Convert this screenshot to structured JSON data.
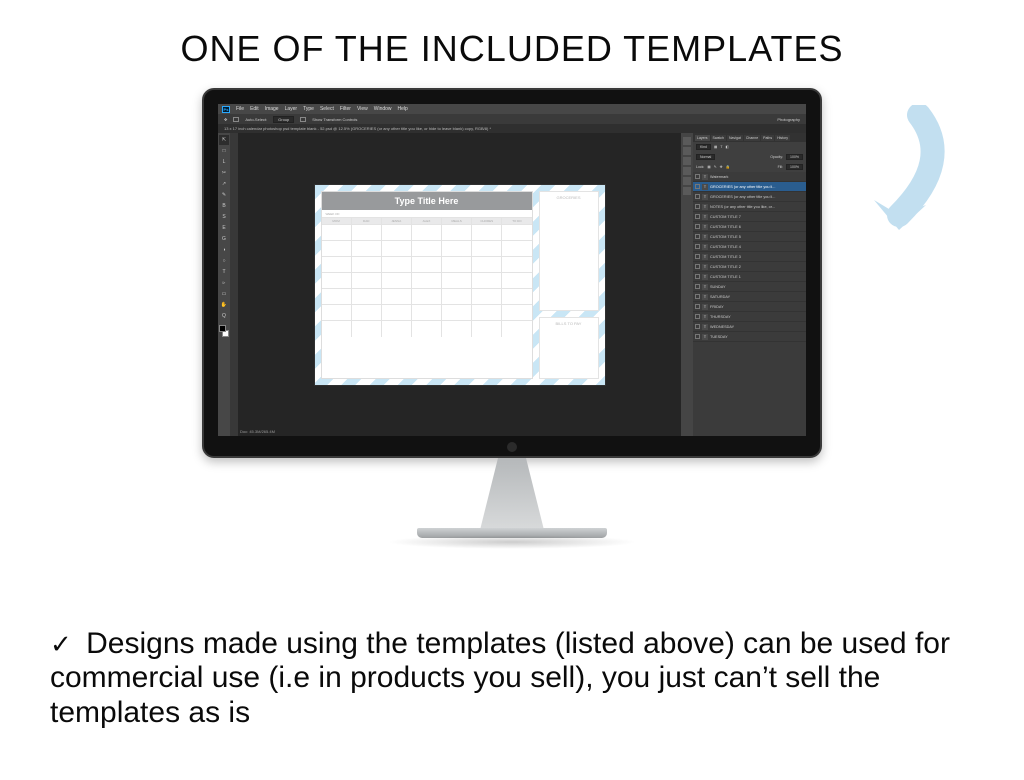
{
  "heading": "ONE OF THE INCLUDED TEMPLATES",
  "body_text": "Designs made using the templates (listed above) can be used for commercial use (i.e in products you sell), you just can’t sell the templates as is",
  "checkmark": "✓",
  "photoshop": {
    "logo": "Ps",
    "menu": [
      "File",
      "Edit",
      "Image",
      "Layer",
      "Type",
      "Select",
      "Filter",
      "View",
      "Window",
      "Help"
    ],
    "options": {
      "auto_select": "Auto-Select:",
      "group": "Group",
      "show_transform": "Show Transform Controls",
      "workspace": "Photography"
    },
    "tab_title": "13 x 17 inch calendar photoshop psd template blank - 52.psd @ 12.5% (GROCERIES (or any other title you like, or hide to leave blank) copy, RGB/8) *",
    "status": "Doc: 45.3M/265.4M",
    "tools": [
      "⇱",
      "□",
      "L",
      "✂",
      "↗",
      "✎",
      "B",
      "S",
      "E",
      "G",
      "◑",
      "○",
      "T",
      "▹",
      "▭",
      "✋",
      "Q"
    ],
    "right_panel_tabs": [
      "Layers",
      "Swatch",
      "Navigat",
      "Channe",
      "Paths",
      "History"
    ],
    "layer_controls": {
      "kind": "Kind",
      "mode": "Normal",
      "opacity_label": "Opacity:",
      "opacity": "100%",
      "lock_label": "Lock:",
      "fill_label": "Fill:",
      "fill": "100%"
    },
    "layers": [
      {
        "type": "T",
        "name": "Watermark",
        "selected": false
      },
      {
        "type": "T",
        "name": "GROCERIES (or any other title you li...",
        "selected": true
      },
      {
        "type": "T",
        "name": "GROCERIES (or any other title you li...",
        "selected": false
      },
      {
        "type": "T",
        "name": "NOTES (or any other title you like, or...",
        "selected": false
      },
      {
        "type": "T",
        "name": "CUSTOM TITLE 7",
        "selected": false
      },
      {
        "type": "T",
        "name": "CUSTOM TITLE 6",
        "selected": false
      },
      {
        "type": "T",
        "name": "CUSTOM TITLE 5",
        "selected": false
      },
      {
        "type": "T",
        "name": "CUSTOM TITLE 4",
        "selected": false
      },
      {
        "type": "T",
        "name": "CUSTOM TITLE 3",
        "selected": false
      },
      {
        "type": "T",
        "name": "CUSTOM TITLE 2",
        "selected": false
      },
      {
        "type": "T",
        "name": "CUSTOM TITLE 1",
        "selected": false
      },
      {
        "type": "T",
        "name": "SUNDAY",
        "selected": false
      },
      {
        "type": "T",
        "name": "SATURDAY",
        "selected": false
      },
      {
        "type": "T",
        "name": "FRIDAY",
        "selected": false
      },
      {
        "type": "T",
        "name": "THURSDAY",
        "selected": false
      },
      {
        "type": "T",
        "name": "WEDNESDAY",
        "selected": false
      },
      {
        "type": "T",
        "name": "TUESDAY",
        "selected": false
      }
    ]
  },
  "template": {
    "title": "Type Title Here",
    "week_of": "WEEK OF:",
    "columns": [
      "MOM",
      "DAD",
      "JENNA",
      "ALEX",
      "MEALS",
      "CHORES",
      "TO DO"
    ],
    "side1": "GROCERIES",
    "side2": "BILLS TO PAY"
  }
}
